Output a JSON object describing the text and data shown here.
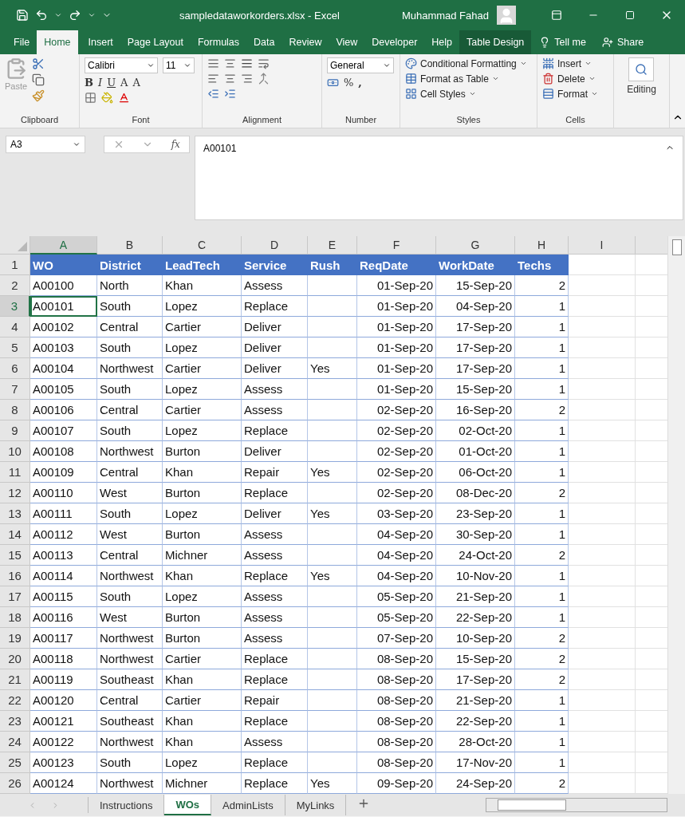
{
  "window": {
    "title": "sampledataworkorders.xlsx  -  Excel",
    "user": "Muhammad Fahad"
  },
  "ribbon_tabs": [
    {
      "label": "File",
      "selected": false,
      "contextual": false
    },
    {
      "label": "Home",
      "selected": true,
      "contextual": false
    },
    {
      "label": "Insert",
      "selected": false,
      "contextual": false
    },
    {
      "label": "Page Layout",
      "selected": false,
      "contextual": false
    },
    {
      "label": "Formulas",
      "selected": false,
      "contextual": false
    },
    {
      "label": "Data",
      "selected": false,
      "contextual": false
    },
    {
      "label": "Review",
      "selected": false,
      "contextual": false
    },
    {
      "label": "View",
      "selected": false,
      "contextual": false
    },
    {
      "label": "Developer",
      "selected": false,
      "contextual": false
    },
    {
      "label": "Help",
      "selected": false,
      "contextual": false
    },
    {
      "label": "Table Design",
      "selected": false,
      "contextual": true
    }
  ],
  "tell_me": "Tell me",
  "share": "Share",
  "ribbon": {
    "paste": "Paste",
    "font_name": "Calibri",
    "font_size": "11",
    "bold": "B",
    "italic": "I",
    "underline": "U",
    "grow": "A",
    "shrink": "A",
    "number_format": "General",
    "percent": "%",
    "comma": ",",
    "styles": [
      "Conditional Formatting",
      "Format as Table",
      "Cell Styles"
    ],
    "cells": [
      "Insert",
      "Delete",
      "Format"
    ],
    "editing": "Editing",
    "groups": [
      "Clipboard",
      "Font",
      "Alignment",
      "Number",
      "Styles",
      "Cells"
    ]
  },
  "formula_bar": {
    "name_box": "A3",
    "fx": "fx",
    "value": "A00101"
  },
  "columns": [
    {
      "label": "A",
      "selected": true
    },
    {
      "label": "B",
      "selected": false
    },
    {
      "label": "C",
      "selected": false
    },
    {
      "label": "D",
      "selected": false
    },
    {
      "label": "E",
      "selected": false
    },
    {
      "label": "F",
      "selected": false
    },
    {
      "label": "G",
      "selected": false
    },
    {
      "label": "H",
      "selected": false
    },
    {
      "label": "I",
      "selected": false
    }
  ],
  "table": {
    "header_row": "1",
    "headers": [
      "WO",
      "District",
      "LeadTech",
      "Service",
      "Rush",
      "ReqDate",
      "WorkDate",
      "Techs"
    ],
    "rows": [
      {
        "number": "2",
        "selected": false,
        "cells": [
          "A00100",
          "North",
          "Khan",
          "Assess",
          null,
          "01-Sep-20",
          "15-Sep-20",
          "2"
        ]
      },
      {
        "number": "3",
        "selected": true,
        "cells": [
          "A00101",
          "South",
          "Lopez",
          "Replace",
          null,
          "01-Sep-20",
          "04-Sep-20",
          "1"
        ]
      },
      {
        "number": "4",
        "selected": false,
        "cells": [
          "A00102",
          "Central",
          "Cartier",
          "Deliver",
          null,
          "01-Sep-20",
          "17-Sep-20",
          "1"
        ]
      },
      {
        "number": "5",
        "selected": false,
        "cells": [
          "A00103",
          "South",
          "Lopez",
          "Deliver",
          null,
          "01-Sep-20",
          "17-Sep-20",
          "1"
        ]
      },
      {
        "number": "6",
        "selected": false,
        "cells": [
          "A00104",
          "Northwest",
          "Cartier",
          "Deliver",
          "Yes",
          "01-Sep-20",
          "17-Sep-20",
          "1"
        ]
      },
      {
        "number": "7",
        "selected": false,
        "cells": [
          "A00105",
          "South",
          "Lopez",
          "Assess",
          null,
          "01-Sep-20",
          "15-Sep-20",
          "1"
        ]
      },
      {
        "number": "8",
        "selected": false,
        "cells": [
          "A00106",
          "Central",
          "Cartier",
          "Assess",
          null,
          "02-Sep-20",
          "16-Sep-20",
          "2"
        ]
      },
      {
        "number": "9",
        "selected": false,
        "cells": [
          "A00107",
          "South",
          "Lopez",
          "Replace",
          null,
          "02-Sep-20",
          "02-Oct-20",
          "1"
        ]
      },
      {
        "number": "10",
        "selected": false,
        "cells": [
          "A00108",
          "Northwest",
          "Burton",
          "Deliver",
          null,
          "02-Sep-20",
          "01-Oct-20",
          "1"
        ]
      },
      {
        "number": "11",
        "selected": false,
        "cells": [
          "A00109",
          "Central",
          "Khan",
          "Repair",
          "Yes",
          "02-Sep-20",
          "06-Oct-20",
          "1"
        ]
      },
      {
        "number": "12",
        "selected": false,
        "cells": [
          "A00110",
          "West",
          "Burton",
          "Replace",
          null,
          "02-Sep-20",
          "08-Dec-20",
          "2"
        ]
      },
      {
        "number": "13",
        "selected": false,
        "cells": [
          "A00111",
          "South",
          "Lopez",
          "Deliver",
          "Yes",
          "03-Sep-20",
          "23-Sep-20",
          "1"
        ]
      },
      {
        "number": "14",
        "selected": false,
        "cells": [
          "A00112",
          "West",
          "Burton",
          "Assess",
          null,
          "04-Sep-20",
          "30-Sep-20",
          "1"
        ]
      },
      {
        "number": "15",
        "selected": false,
        "cells": [
          "A00113",
          "Central",
          "Michner",
          "Assess",
          null,
          "04-Sep-20",
          "24-Oct-20",
          "2"
        ]
      },
      {
        "number": "16",
        "selected": false,
        "cells": [
          "A00114",
          "Northwest",
          "Khan",
          "Replace",
          "Yes",
          "04-Sep-20",
          "10-Nov-20",
          "1"
        ]
      },
      {
        "number": "17",
        "selected": false,
        "cells": [
          "A00115",
          "South",
          "Lopez",
          "Assess",
          null,
          "05-Sep-20",
          "21-Sep-20",
          "1"
        ]
      },
      {
        "number": "18",
        "selected": false,
        "cells": [
          "A00116",
          "West",
          "Burton",
          "Assess",
          null,
          "05-Sep-20",
          "22-Sep-20",
          "1"
        ]
      },
      {
        "number": "19",
        "selected": false,
        "cells": [
          "A00117",
          "Northwest",
          "Burton",
          "Assess",
          null,
          "07-Sep-20",
          "10-Sep-20",
          "2"
        ]
      },
      {
        "number": "20",
        "selected": false,
        "cells": [
          "A00118",
          "Northwest",
          "Cartier",
          "Replace",
          null,
          "08-Sep-20",
          "15-Sep-20",
          "2"
        ]
      },
      {
        "number": "21",
        "selected": false,
        "cells": [
          "A00119",
          "Southeast",
          "Khan",
          "Replace",
          null,
          "08-Sep-20",
          "17-Sep-20",
          "2"
        ]
      },
      {
        "number": "22",
        "selected": false,
        "cells": [
          "A00120",
          "Central",
          "Cartier",
          "Repair",
          null,
          "08-Sep-20",
          "21-Sep-20",
          "1"
        ]
      },
      {
        "number": "23",
        "selected": false,
        "cells": [
          "A00121",
          "Southeast",
          "Khan",
          "Replace",
          null,
          "08-Sep-20",
          "22-Sep-20",
          "1"
        ]
      },
      {
        "number": "24",
        "selected": false,
        "cells": [
          "A00122",
          "Northwest",
          "Khan",
          "Assess",
          null,
          "08-Sep-20",
          "28-Oct-20",
          "1"
        ]
      },
      {
        "number": "25",
        "selected": false,
        "cells": [
          "A00123",
          "South",
          "Lopez",
          "Replace",
          null,
          "08-Sep-20",
          "17-Nov-20",
          "1"
        ]
      },
      {
        "number": "26",
        "selected": false,
        "cells": [
          "A00124",
          "Northwest",
          "Michner",
          "Replace",
          "Yes",
          "09-Sep-20",
          "24-Sep-20",
          "2"
        ]
      }
    ]
  },
  "sheet_tabs": [
    {
      "label": "Instructions",
      "selected": false
    },
    {
      "label": "WOs",
      "selected": true
    },
    {
      "label": "AdminLists",
      "selected": false
    },
    {
      "label": "MyLinks",
      "selected": false
    }
  ]
}
